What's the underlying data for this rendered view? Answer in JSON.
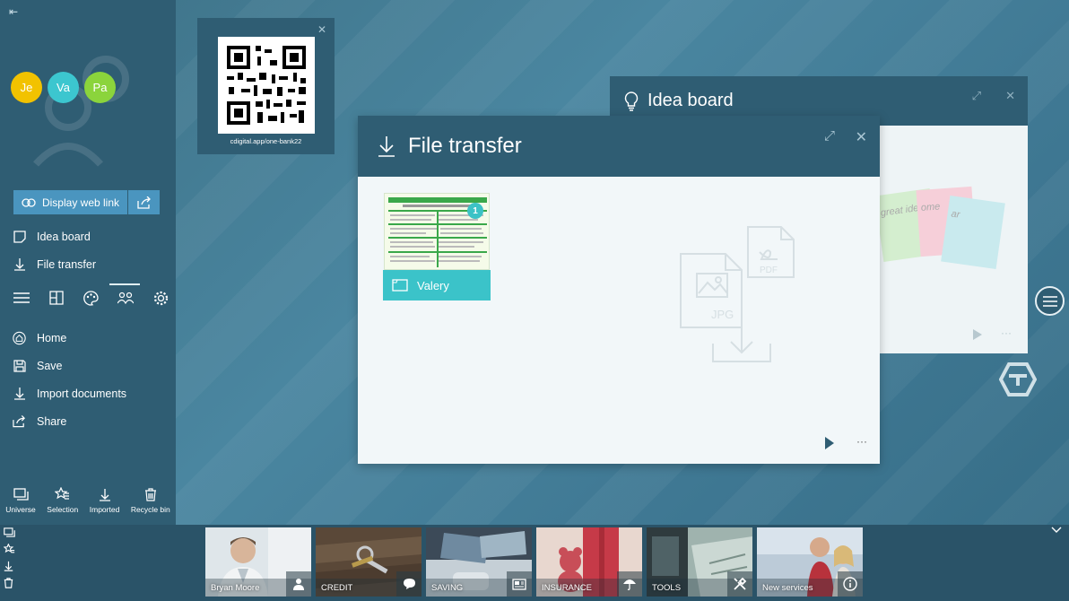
{
  "sidebar": {
    "avatars": [
      {
        "initials": "Je",
        "color": "#f2c200"
      },
      {
        "initials": "Va",
        "color": "#3cc6cf"
      },
      {
        "initials": "Pa",
        "color": "#8bd43c"
      }
    ],
    "weblink_label": "Display web link",
    "panels": [
      {
        "label": "Idea board",
        "icon": "sticky-note-icon"
      },
      {
        "label": "File transfer",
        "icon": "download-icon"
      }
    ],
    "menu": [
      {
        "label": "Home",
        "icon": "home-icon"
      },
      {
        "label": "Save",
        "icon": "save-icon"
      },
      {
        "label": "Import documents",
        "icon": "download-icon"
      },
      {
        "label": "Share",
        "icon": "share-icon"
      }
    ],
    "bottom_tools": [
      {
        "label": "Universe",
        "icon": "universe-icon"
      },
      {
        "label": "Selection",
        "icon": "star-list-icon"
      },
      {
        "label": "Imported",
        "icon": "download-icon"
      },
      {
        "label": "Recycle bin",
        "icon": "trash-icon"
      }
    ]
  },
  "qr_widget": {
    "url": "cdigital.app/one-bank22"
  },
  "idea_board": {
    "title": "Idea board",
    "notes": [
      "great idea",
      "ome",
      "ar"
    ]
  },
  "file_transfer": {
    "title": "File transfer",
    "document": {
      "owner": "Valery",
      "badge": "1"
    },
    "dropzone_labels": [
      "JPG",
      "PDF"
    ]
  },
  "services": [
    {
      "label": "Bryan Moore",
      "icon": "person-icon",
      "color": "#c9d6dc"
    },
    {
      "label": "CREDIT",
      "icon": "chat-icon",
      "color": "#6b5a45"
    },
    {
      "label": "SAVING",
      "icon": "newspaper-icon",
      "color": "#8da2b0"
    },
    {
      "label": "INSURANCE",
      "icon": "umbrella-icon",
      "color": "#c54a55"
    },
    {
      "label": "TOOLS",
      "icon": "tools-icon",
      "color": "#7d9690"
    },
    {
      "label": "New services",
      "icon": "info-icon",
      "color": "#9fb6c8"
    }
  ]
}
